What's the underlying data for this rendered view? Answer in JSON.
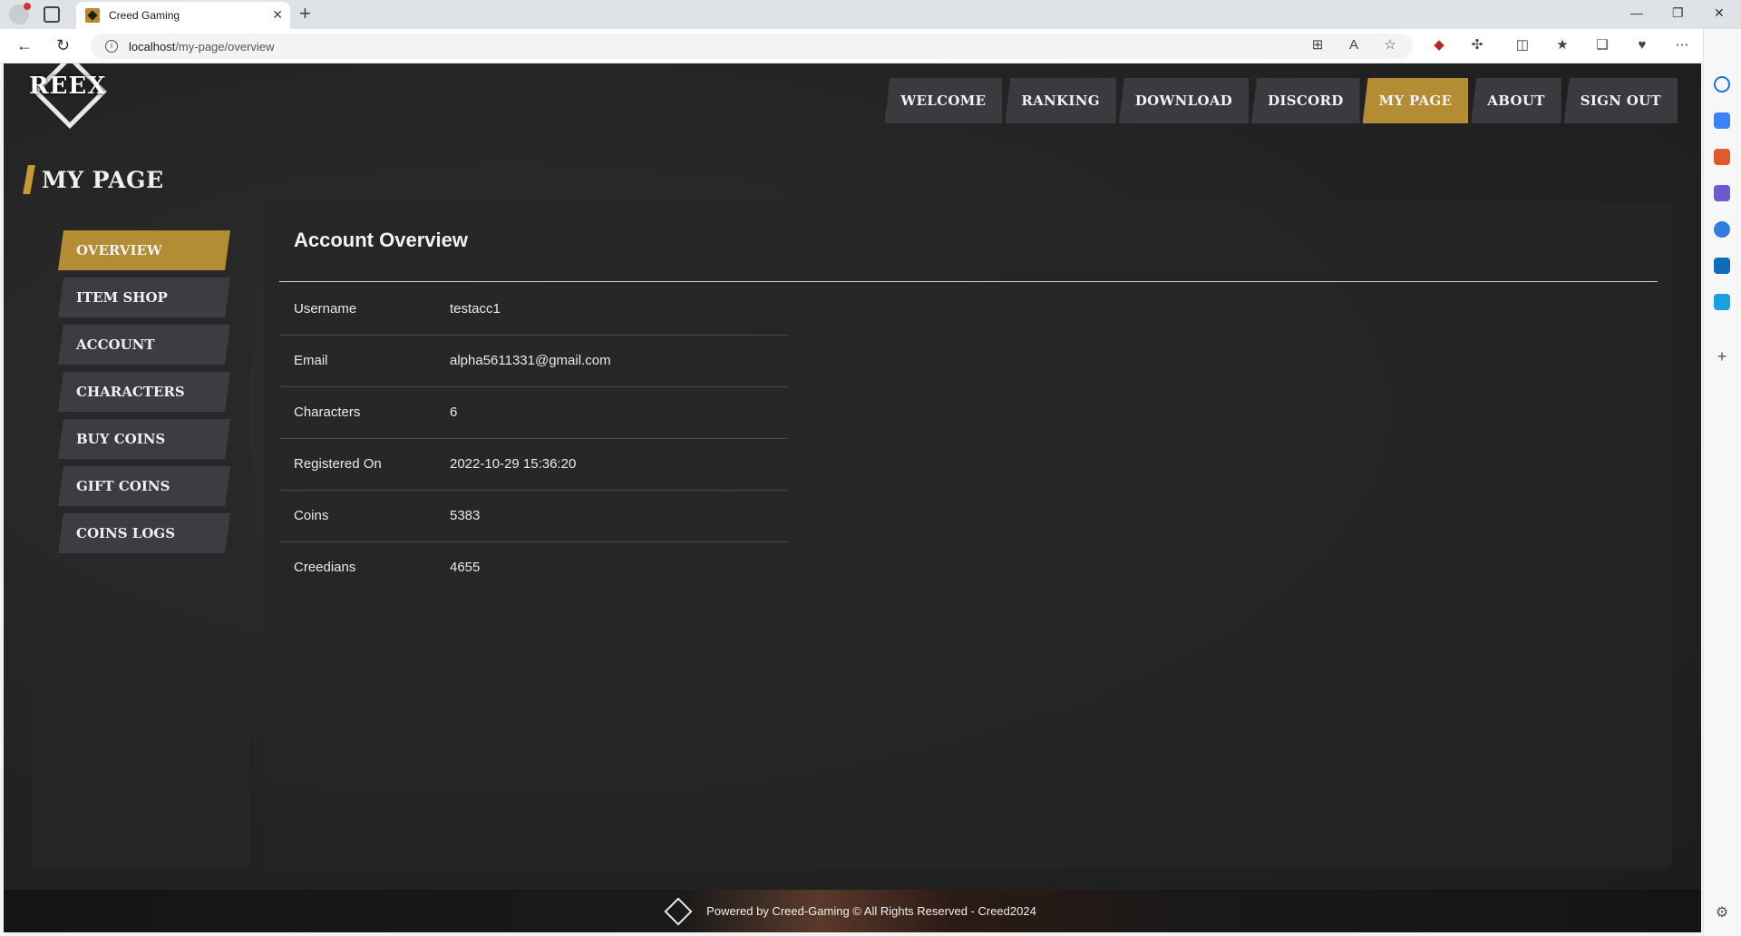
{
  "browser": {
    "tab_title": "Creed Gaming",
    "url_host": "localhost",
    "url_path": "/my-page/overview"
  },
  "site": {
    "logo_text": "REEX",
    "nav": [
      {
        "label": "WELCOME"
      },
      {
        "label": "RANKING"
      },
      {
        "label": "DOWNLOAD"
      },
      {
        "label": "DISCORD"
      },
      {
        "label": "MY PAGE",
        "active": true
      },
      {
        "label": "ABOUT"
      },
      {
        "label": "SIGN OUT"
      }
    ],
    "page_title": "MY PAGE"
  },
  "sidemenu": [
    {
      "label": "OVERVIEW",
      "active": true
    },
    {
      "label": "ITEM SHOP"
    },
    {
      "label": "ACCOUNT"
    },
    {
      "label": "CHARACTERS"
    },
    {
      "label": "BUY COINS"
    },
    {
      "label": "GIFT COINS"
    },
    {
      "label": "COINS LOGS"
    }
  ],
  "overview": {
    "heading": "Account Overview",
    "rows": [
      {
        "label": "Username",
        "value": "testacc1"
      },
      {
        "label": "Email",
        "value": "alpha5611331@gmail.com"
      },
      {
        "label": "Characters",
        "value": "6"
      },
      {
        "label": "Registered On",
        "value": "2022-10-29 15:36:20"
      },
      {
        "label": "Coins",
        "value": "5383"
      },
      {
        "label": "Creedians",
        "value": "4655"
      }
    ]
  },
  "footer": {
    "text": "Powered by Creed-Gaming © All Rights Reserved - Creed2024"
  },
  "colors": {
    "accent": "#b38c34",
    "button": "#3c3d42",
    "background": "#252525"
  }
}
